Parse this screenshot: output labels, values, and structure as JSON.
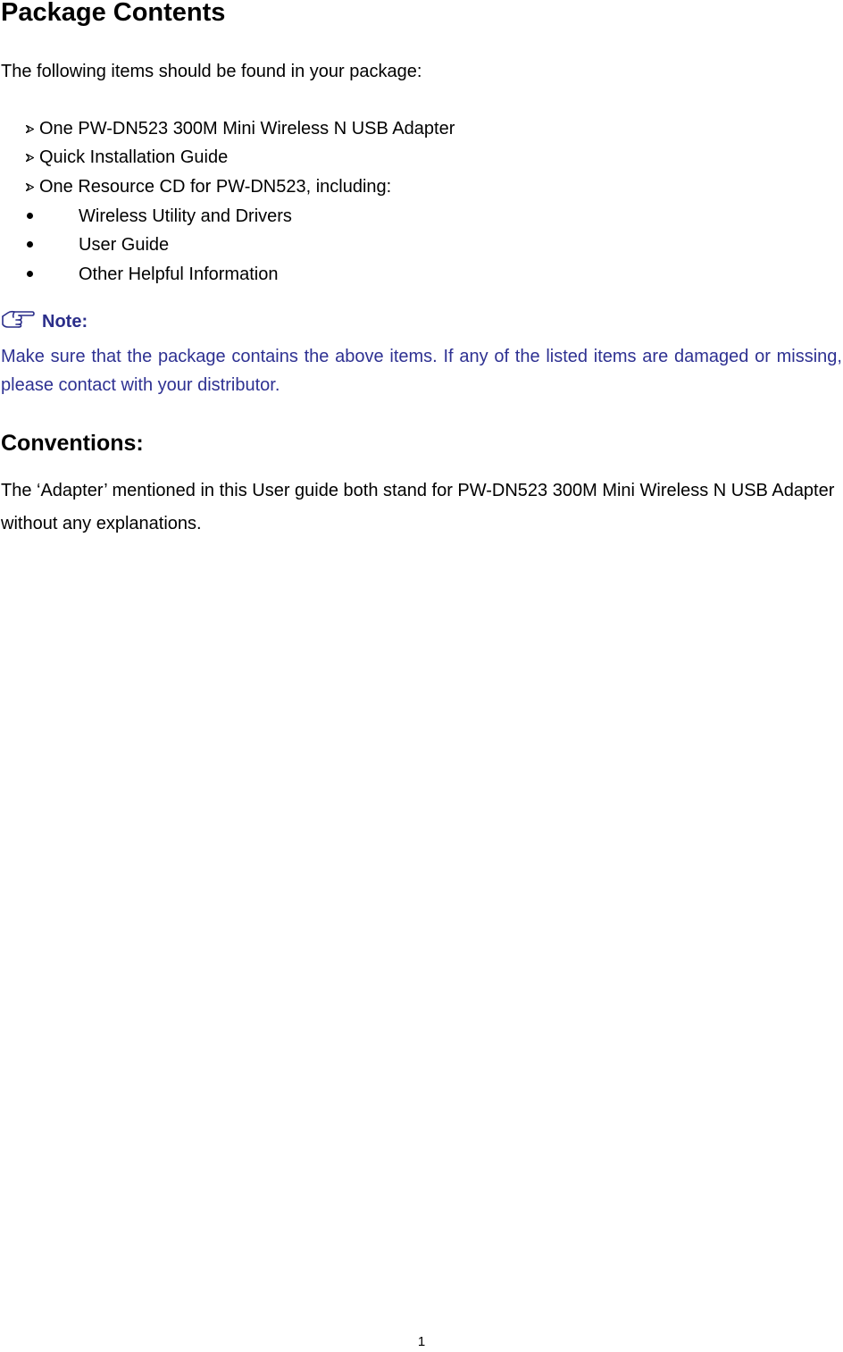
{
  "title": "Package Contents",
  "intro": "The following items should be found in your package:",
  "package_items": [
    "One PW-DN523 300M Mini Wireless N USB Adapter",
    "Quick Installation Guide",
    "One Resource CD for PW-DN523, including:"
  ],
  "cd_items": [
    "Wireless Utility and Drivers",
    "User Guide",
    "Other Helpful Information"
  ],
  "note": {
    "icon": "pointing-hand-icon",
    "label": "Note:",
    "text": "Make sure that the package contains the above items. If any of the listed items are damaged or missing, please contact with your distributor.",
    "color": "#2e3192"
  },
  "conventions": {
    "title": "Conventions:",
    "text": "The ‘Adapter’ mentioned in this User guide both stand for PW-DN523 300M Mini Wireless N USB Adapter without any explanations."
  },
  "footer": {
    "page_number": "1"
  }
}
